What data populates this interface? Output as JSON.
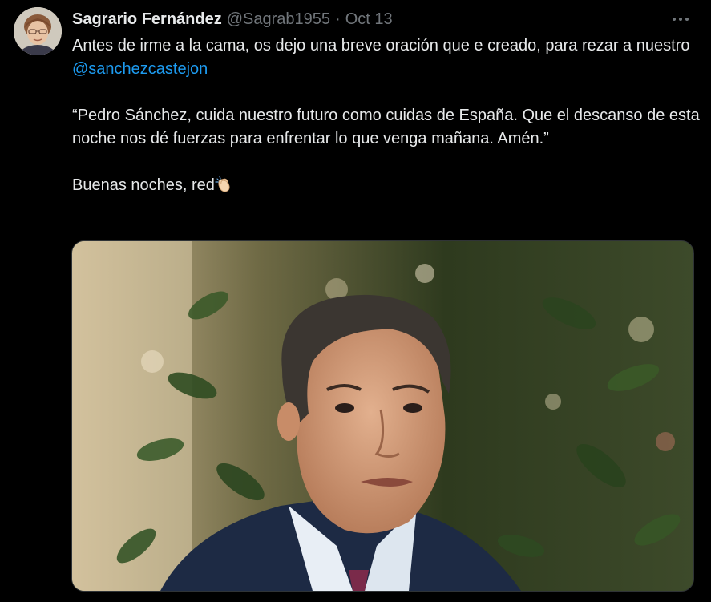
{
  "tweet": {
    "author": {
      "display_name": "Sagrario Fernández",
      "handle": "@Sagrab1955",
      "separator": "·",
      "date": "Oct 13"
    },
    "lines": {
      "p1_text": "Antes de irme a la cama, os dejo una breve oración que e creado, para rezar a nuestro ",
      "p1_mention": "@sanchezcastejon",
      "p2": "“Pedro Sánchez, cuida nuestro futuro como cuidas de España. Que el descanso de esta noche nos dé fuerzas para enfrentar lo que venga mañana. Amén.”",
      "p3": "Buenas noches, red"
    },
    "emoji": "clapping-hands-icon",
    "more_menu": "more-options-icon",
    "colors": {
      "background": "#000000",
      "text": "#e7e9ea",
      "secondary": "#71767b",
      "link": "#1d9bf0",
      "border": "#2f3336"
    }
  }
}
